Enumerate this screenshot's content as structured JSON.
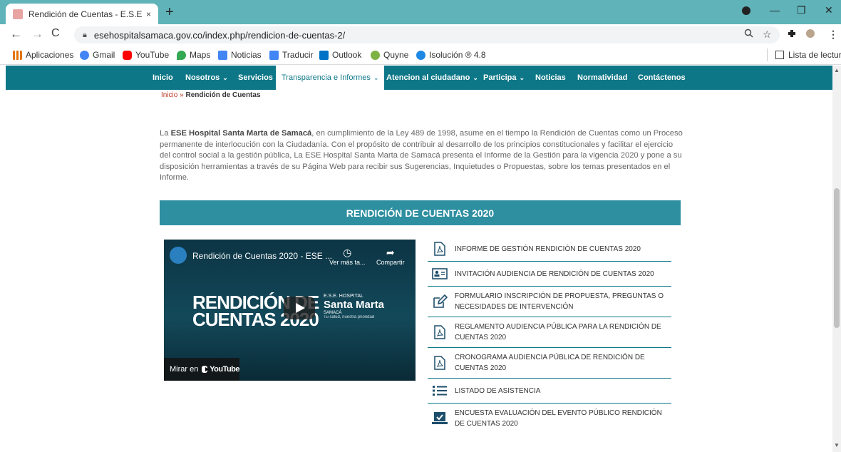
{
  "browser": {
    "tab_title": "Rendición de Cuentas - E.S.E. HO",
    "tab_close": "×",
    "new_tab": "+",
    "url": "esehospitalsamaca.gov.co/index.php/rendicion-de-cuentas-2/",
    "bookmarks": [
      {
        "label": "Aplicaciones",
        "color": "#e37400"
      },
      {
        "label": "Gmail",
        "color": "#4285f4"
      },
      {
        "label": "YouTube",
        "color": "#ff0000"
      },
      {
        "label": "Maps",
        "color": "#34a853"
      },
      {
        "label": "Noticias",
        "color": "#4285f4"
      },
      {
        "label": "Traducir",
        "color": "#4285f4"
      },
      {
        "label": "Outlook",
        "color": "#0072c6"
      },
      {
        "label": "Quyne",
        "color": "#7cb342"
      },
      {
        "label": "Isolución ® 4.8",
        "color": "#1e88e5"
      }
    ],
    "reading_list": "Lista de lectura"
  },
  "site_nav": {
    "items": [
      {
        "label": "Inicio"
      },
      {
        "label": "Nosotros",
        "chevron": "⌄"
      },
      {
        "label": "Servicios"
      },
      {
        "label": "Transparencia e Informes",
        "chevron": "⌄"
      },
      {
        "label": "Atencion al ciudadano",
        "chevron": "⌄"
      },
      {
        "label": "Participa",
        "chevron": "⌄"
      },
      {
        "label": "Noticias"
      },
      {
        "label": "Normatividad"
      },
      {
        "label": "Contáctenos"
      }
    ]
  },
  "breadcrumb": {
    "home": "Inicio",
    "sep": " » ",
    "current": "Rendición de Cuentas"
  },
  "intro": {
    "prefix": "La ",
    "bold": "ESE Hospital Santa Marta de Samacá",
    "text": ", en cumplimiento de la Ley 489 de 1998, asume en el tiempo la Rendición de Cuentas como un Proceso permanente de interlocución con la Ciudadanía. Con el propósito de contribuir al desarrollo de los principios constitucionales y facilitar el ejercicio del control social a la gestión pública, La ESE Hospital Santa Marta de Samacá presenta el Informe de la Gestión para la vigencia 2020 y pone a su disposición herramientas a través de su Página Web para recibir sus Sugerencias, Inquietudes o Propuestas, sobre los temas presentados en el Informe."
  },
  "section_title": "RENDICIÓN DE CUENTAS 2020",
  "video": {
    "title": "Rendición de Cuentas 2020 - ESE ...",
    "watch_later": "Ver más ta...",
    "share": "Compartir",
    "thumb_line1": "RENDICIÓN DE",
    "thumb_line2": "CUENTAS 2020",
    "logo_top": "E.S.E. HOSPITAL",
    "logo_name": "Santa Marta",
    "logo_place": "SAMACÁ",
    "logo_slogan": "Tu salud, nuestra prioridad",
    "watch_on": "Mirar en",
    "youtube": "YouTube"
  },
  "documents": [
    {
      "label": "INFORME DE GESTIÓN RENDICIÓN DE CUENTAS 2020",
      "icon": "pdf-icon"
    },
    {
      "label": "INVITACIÓN AUDIENCIA DE RENDICIÓN DE CUENTAS 2020",
      "icon": "id-card-icon"
    },
    {
      "label": "FORMULARIO INSCRIPCIÓN DE PROPUESTA, PREGUNTAS O NECESIDADES DE INTERVENCIÓN",
      "icon": "edit-icon"
    },
    {
      "label": "REGLAMENTO AUDIENCIA PÚBLICA PARA LA RENDICIÓN DE CUENTAS 2020",
      "icon": "pdf-icon"
    },
    {
      "label": "CRONOGRAMA AUDIENCIA PÚBLICA DE RENDICIÓN DE CUENTAS 2020",
      "icon": "pdf-icon"
    },
    {
      "label": "LISTADO DE ASISTENCIA",
      "icon": "list-icon"
    },
    {
      "label": "ENCUESTA EVALUACIÓN DEL EVENTO PÚBLICO RENDICIÓN DE CUENTAS 2020",
      "icon": "laptop-check-icon"
    }
  ],
  "colors": {
    "nav": "#0d7787",
    "section": "#2e8fa0",
    "chrome": "#5fb3b9"
  }
}
